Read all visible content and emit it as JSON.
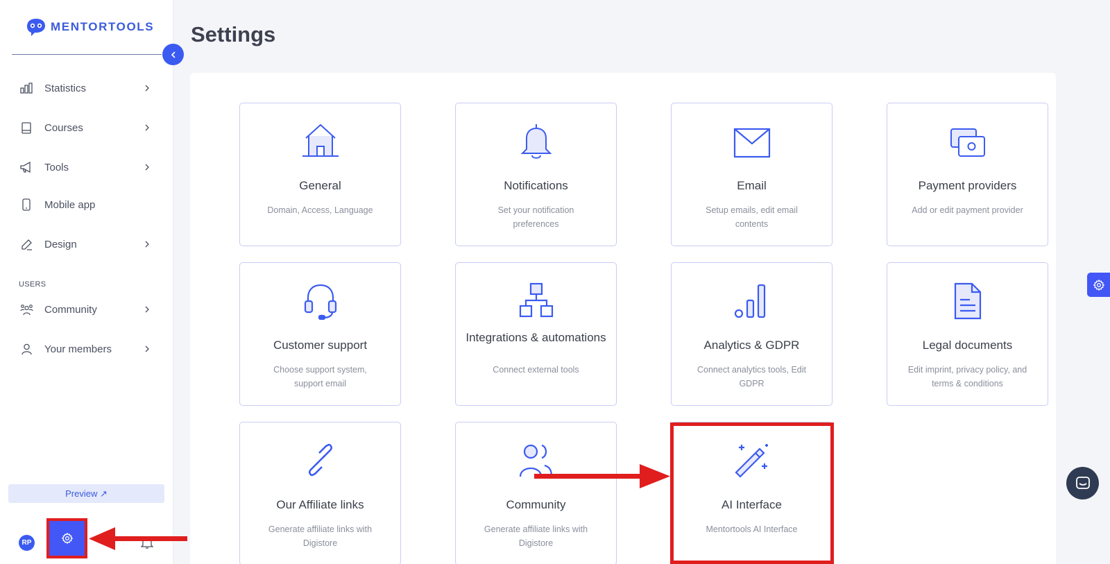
{
  "brand": {
    "name": "MENTORTOOLS"
  },
  "sidebar": {
    "items": [
      {
        "label": "Statistics",
        "icon": "bar-chart-icon"
      },
      {
        "label": "Courses",
        "icon": "book-icon"
      },
      {
        "label": "Tools",
        "icon": "megaphone-icon"
      },
      {
        "label": "Mobile app",
        "icon": "phone-icon"
      },
      {
        "label": "Design",
        "icon": "pencil-icon"
      }
    ],
    "users_section_label": "USERS",
    "user_items": [
      {
        "label": "Community",
        "icon": "people-icon"
      },
      {
        "label": "Your members",
        "icon": "user-icon"
      }
    ],
    "preview_label": "Preview ↗",
    "avatar_initials": "RP"
  },
  "page": {
    "title": "Settings"
  },
  "cards": [
    {
      "title": "General",
      "desc": "Domain, Access, Language",
      "icon": "home-icon"
    },
    {
      "title": "Notifications",
      "desc": "Set your notification preferences",
      "icon": "bell-icon"
    },
    {
      "title": "Email",
      "desc": "Setup emails, edit email contents",
      "icon": "envelope-icon"
    },
    {
      "title": "Payment providers",
      "desc": "Add or edit payment provider",
      "icon": "cash-icon"
    },
    {
      "title": "Customer support",
      "desc": "Choose support system, support email",
      "icon": "headset-icon"
    },
    {
      "title": "Integrations & automations",
      "desc": "Connect external tools",
      "icon": "hierarchy-icon"
    },
    {
      "title": "Analytics & GDPR",
      "desc": "Connect analytics tools, Edit GDPR",
      "icon": "analytics-icon"
    },
    {
      "title": "Legal documents",
      "desc": "Edit imprint, privacy policy, and terms & conditions",
      "icon": "document-icon"
    },
    {
      "title": "Our Affiliate links",
      "desc": "Generate affiliate links with Digistore",
      "icon": "link-icon"
    },
    {
      "title": "Community",
      "desc": "Generate affiliate links with Digistore",
      "icon": "community-icon"
    },
    {
      "title": "AI Interface",
      "desc": "Mentortools AI Interface",
      "icon": "magic-wand-icon"
    }
  ],
  "colors": {
    "accent": "#3b5bf0",
    "annotation": "#e01e1e",
    "card_border": "#c9cdf3"
  }
}
